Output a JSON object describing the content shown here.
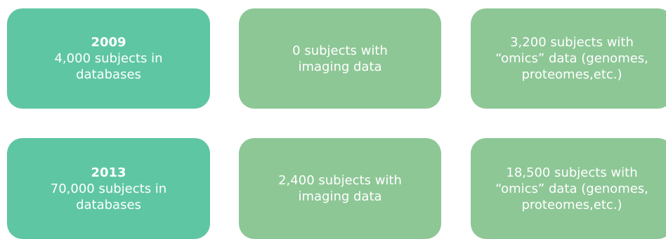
{
  "rows": [
    {
      "year": "2009",
      "databases": [
        "4,000 subjects in",
        "databases"
      ],
      "imaging": [
        "0 subjects with",
        "imaging data"
      ],
      "omics": [
        "3,200 subjects with",
        "“omics” data (genomes,",
        "proteomes,etc.)"
      ]
    },
    {
      "year": "2013",
      "databases": [
        "70,000 subjects in",
        "databases"
      ],
      "imaging": [
        "2,400 subjects with",
        "imaging data"
      ],
      "omics": [
        "18,500 subjects with",
        "“omics” data (genomes,",
        "proteomes,etc.)"
      ]
    }
  ],
  "colors": {
    "databases_card": "#5fc6a4",
    "other_card": "#8dc796",
    "text": "#ffffff"
  }
}
